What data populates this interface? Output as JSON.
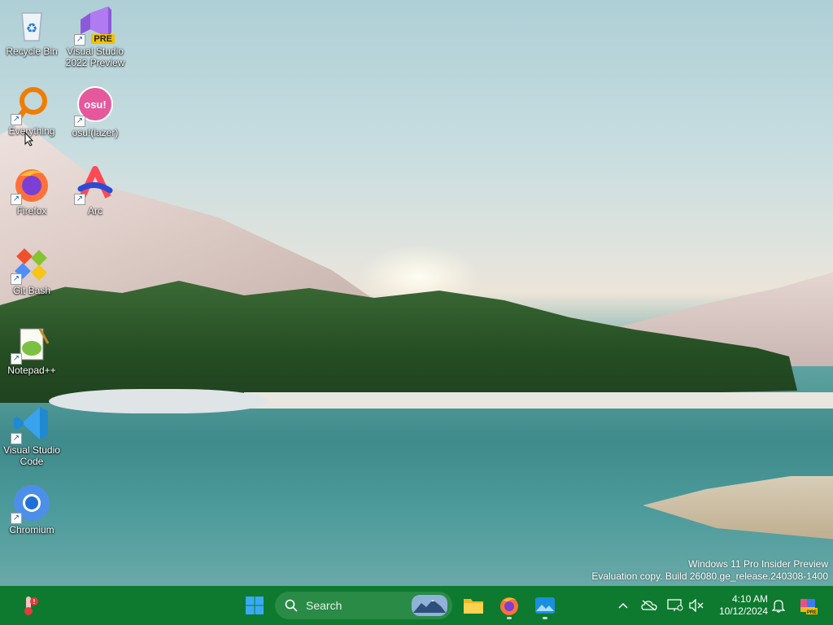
{
  "desktop_icons": [
    {
      "label": "Recycle Bin"
    },
    {
      "label": "Visual Studio 2022 Preview",
      "badge": "PRE"
    },
    {
      "label": "Everything"
    },
    {
      "label": "osu!(lazer)",
      "logo_text": "osu!"
    },
    {
      "label": "Firefox"
    },
    {
      "label": "Arc"
    },
    {
      "label": "Git Bash"
    },
    {
      "label": "Notepad++"
    },
    {
      "label": "Visual Studio Code"
    },
    {
      "label": "Chromium"
    }
  ],
  "watermark": {
    "line1": "Windows 11 Pro Insider Preview",
    "line2": "Evaluation copy. Build 26080.ge_release.240308-1400"
  },
  "taskbar": {
    "search_label": "Search",
    "clock_time": "4:10 AM",
    "clock_date": "10/12/2024",
    "accent": "#0d7a2f"
  }
}
